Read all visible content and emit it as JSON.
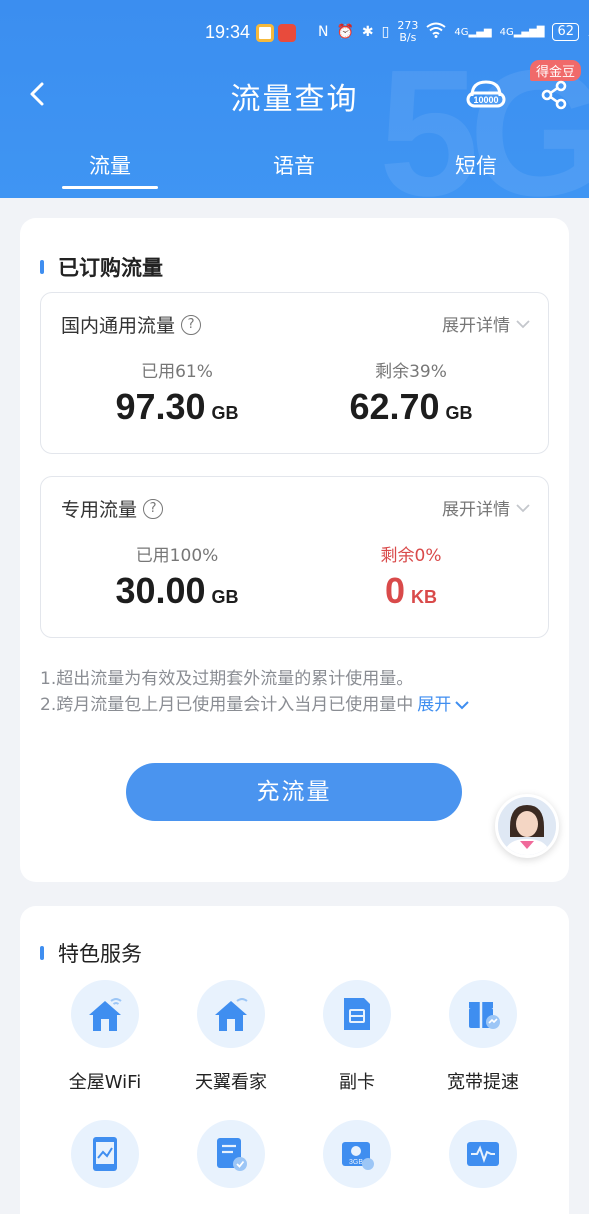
{
  "status": {
    "time": "19:34",
    "speed_value": "273",
    "speed_unit": "B/s",
    "net1": "4G",
    "net2": "4G",
    "battery": "62"
  },
  "header": {
    "title": "流量查询",
    "badge": "得金豆",
    "tabs": [
      {
        "label": "流量",
        "active": true
      },
      {
        "label": "语音",
        "active": false
      },
      {
        "label": "短信",
        "active": false
      }
    ]
  },
  "subscribed": {
    "title": "已订购流量",
    "general": {
      "name": "国内通用流量",
      "help": "?",
      "expand": "展开详情",
      "used_label": "已用61%",
      "used_value": "97.30",
      "used_unit": "GB",
      "remain_label": "剩余39%",
      "remain_value": "62.70",
      "remain_unit": "GB",
      "used_fraction": 0.61
    },
    "dedicated": {
      "name": "专用流量",
      "help": "?",
      "expand": "展开详情",
      "used_label": "已用100%",
      "used_value": "30.00",
      "used_unit": "GB",
      "remain_label": "剩余0%",
      "remain_value": "0",
      "remain_unit": "KB",
      "used_fraction": 1.0
    },
    "notes": [
      "1.超出流量为有效及过期套外流量的累计使用量。",
      "2.跨月流量包上月已使用量会计入当月已使用量中"
    ],
    "notes_expand": "展开",
    "cta": "充流量"
  },
  "services": {
    "title": "特色服务",
    "items": [
      {
        "label": "全屋WiFi",
        "icon": "home-wifi-icon"
      },
      {
        "label": "天翼看家",
        "icon": "home-camera-icon"
      },
      {
        "label": "副卡",
        "icon": "sim-card-icon"
      },
      {
        "label": "宽带提速",
        "icon": "broadband-boost-icon"
      },
      {
        "label": "",
        "icon": "tablet-chart-icon"
      },
      {
        "label": "",
        "icon": "document-check-icon"
      },
      {
        "label": "",
        "icon": "data-package-icon"
      },
      {
        "label": "",
        "icon": "signal-monitor-icon"
      }
    ]
  },
  "colors": {
    "brand_blue": "#3f8ef0",
    "warning_red": "#d94a4a",
    "badge_red": "#f06a6a"
  }
}
